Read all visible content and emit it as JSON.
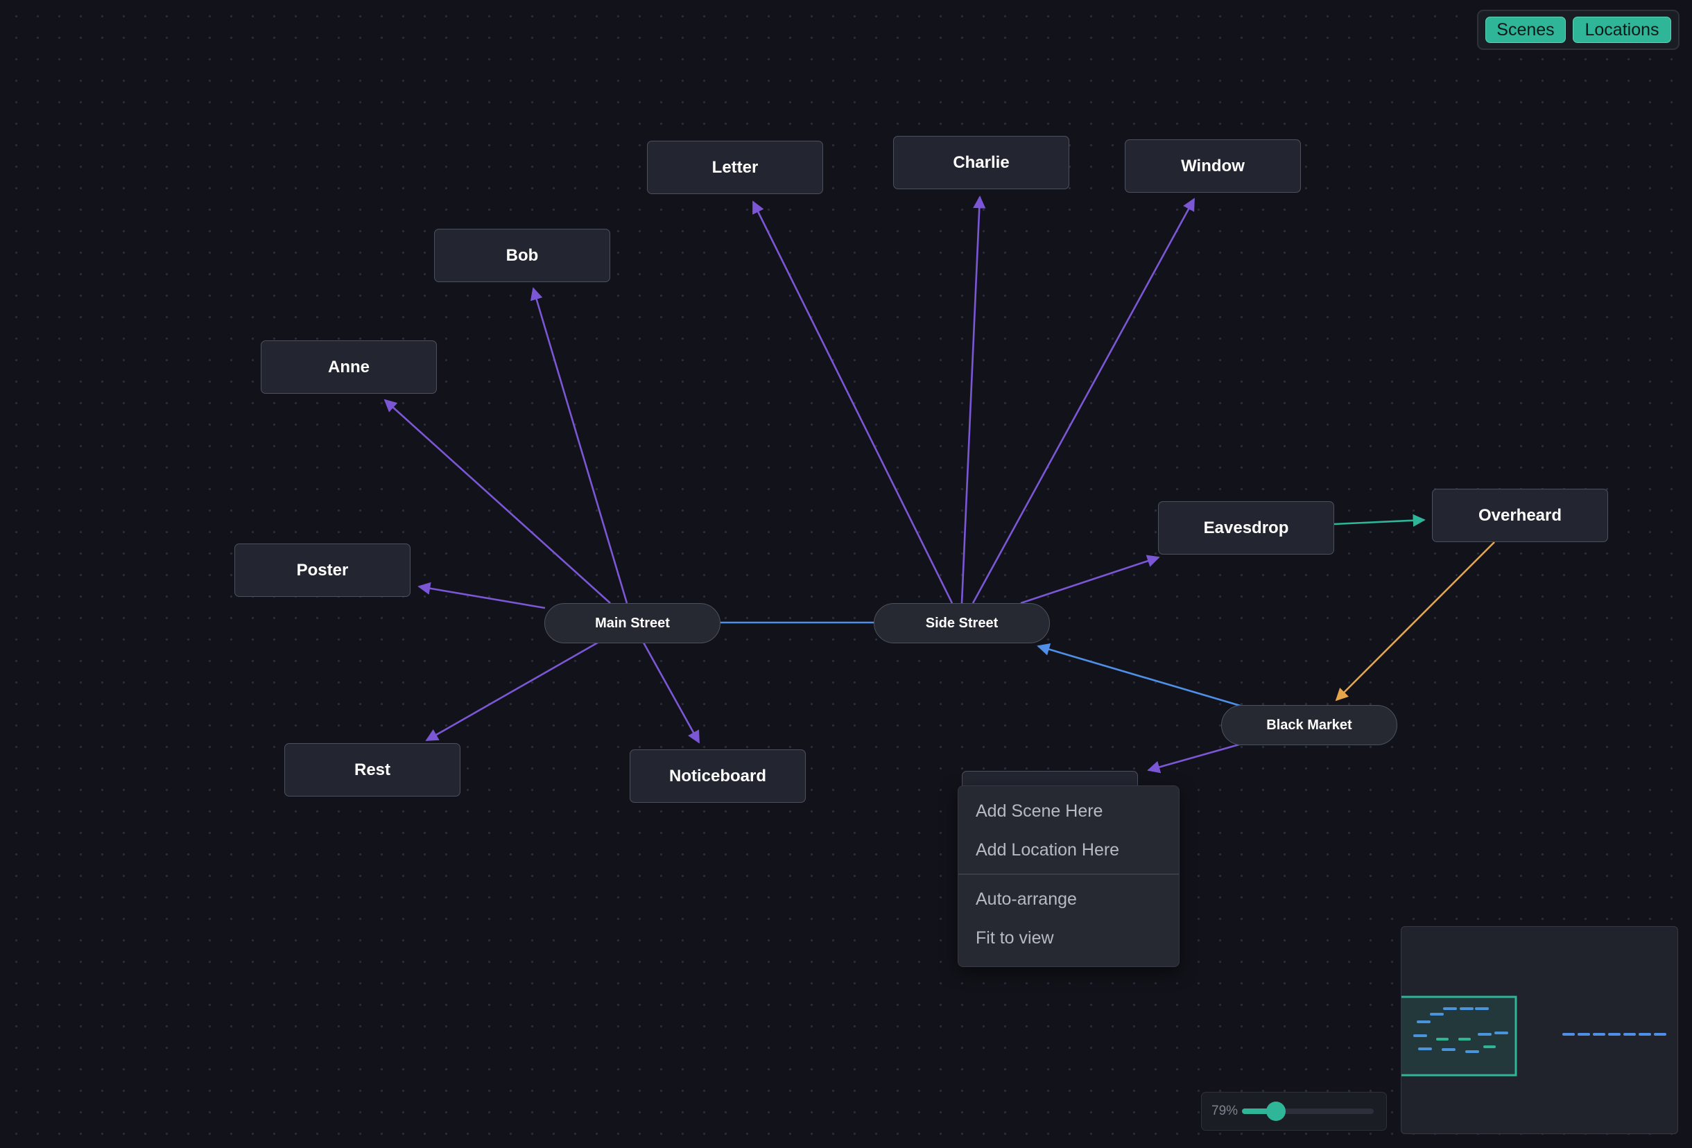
{
  "mode_toggle": {
    "scenes_label": "Scenes",
    "locations_label": "Locations",
    "accent_color": "#2fb597"
  },
  "graph": {
    "edge_colors": {
      "scene_link": "#7b57d6",
      "location_link": "#4f8fe8",
      "scene_to_scene": "#2fb597",
      "scene_to_location": "#e8a64a"
    },
    "scenes": [
      {
        "id": "letter",
        "label": "Letter"
      },
      {
        "id": "charlie",
        "label": "Charlie"
      },
      {
        "id": "window",
        "label": "Window"
      },
      {
        "id": "bob",
        "label": "Bob"
      },
      {
        "id": "anne",
        "label": "Anne"
      },
      {
        "id": "poster",
        "label": "Poster"
      },
      {
        "id": "eavesdrop",
        "label": "Eavesdrop"
      },
      {
        "id": "overheard",
        "label": "Overheard"
      },
      {
        "id": "rest",
        "label": "Rest"
      },
      {
        "id": "noticeboard",
        "label": "Noticeboard"
      }
    ],
    "locations": [
      {
        "id": "main_street",
        "label": "Main Street"
      },
      {
        "id": "side_street",
        "label": "Side Street"
      },
      {
        "id": "black_market",
        "label": "Black Market"
      }
    ]
  },
  "context_menu": {
    "items": [
      {
        "label": "Add Scene Here"
      },
      {
        "label": "Add Location Here"
      }
    ],
    "items_after_separator": [
      {
        "label": "Auto-arrange"
      },
      {
        "label": "Fit to view"
      }
    ]
  },
  "zoom": {
    "label": "79%",
    "level_fraction": 0.26
  },
  "minimap": {
    "viewport_color": "#2fb597",
    "scene_color": "#4f8fe8",
    "location_color": "#2fb597"
  }
}
